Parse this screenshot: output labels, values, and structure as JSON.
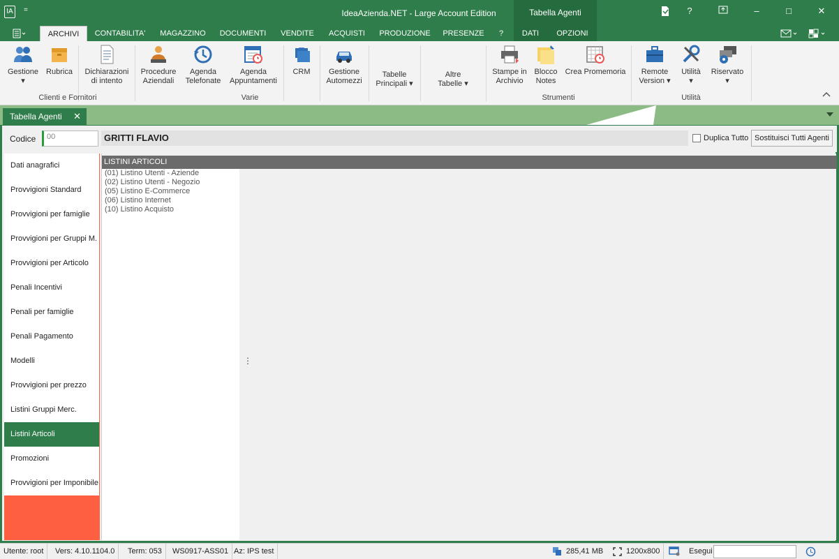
{
  "window": {
    "title": "IdeaAzienda.NET - Large Account Edition",
    "context_tab_title": "Tabella Agenti",
    "help_label": "?",
    "app_icon": "IA",
    "quick_access": "=",
    "controls": {
      "minimize": "–",
      "restore": "□",
      "close": "✕"
    }
  },
  "ribbon_tabs": [
    {
      "label": "ARCHIVI",
      "active": true
    },
    {
      "label": "CONTABILITA'"
    },
    {
      "label": "MAGAZZINO"
    },
    {
      "label": "DOCUMENTI"
    },
    {
      "label": "VENDITE"
    },
    {
      "label": "ACQUISTI"
    },
    {
      "label": "PRODUZIONE"
    },
    {
      "label": "PRESENZE"
    },
    {
      "label": "?"
    },
    {
      "label": "DATI"
    },
    {
      "label": "OPZIONI"
    }
  ],
  "ribbon": {
    "buttons": [
      {
        "label1": "Gestione",
        "label2": "▾",
        "icon": "users-icon"
      },
      {
        "label1": "Rubrica",
        "label2": "",
        "icon": "box-icon"
      },
      {
        "label1": "Dichiarazioni",
        "label2": "di intento",
        "icon": "document-icon"
      },
      {
        "label1": "Procedure",
        "label2": "Aziendali",
        "icon": "worker-icon"
      },
      {
        "label1": "Agenda",
        "label2": "Telefonate",
        "icon": "history-icon"
      },
      {
        "label1": "Agenda",
        "label2": "Appuntamenti",
        "icon": "calendar-clock-icon"
      },
      {
        "label1": "CRM",
        "label2": "",
        "icon": "briefcase-stack-icon"
      },
      {
        "label1": "Gestione",
        "label2": "Automezzi",
        "icon": "car-icon"
      },
      {
        "label1": "Tabelle",
        "label2": "Principali ▾",
        "icon": ""
      },
      {
        "label1": "Altre",
        "label2": "Tabelle ▾",
        "icon": ""
      },
      {
        "label1": "Stampe in",
        "label2": "Archivio",
        "icon": "printer-icon"
      },
      {
        "label1": "Blocco",
        "label2": "Notes",
        "icon": "sticky-note-icon"
      },
      {
        "label1": "Crea Promemoria",
        "label2": "",
        "icon": "calendar-clock-icon"
      },
      {
        "label1": "Remote",
        "label2": "Version ▾",
        "icon": "toolbox-icon"
      },
      {
        "label1": "Utilità",
        "label2": "▾",
        "icon": "tools-icon"
      },
      {
        "label1": "Riservato",
        "label2": "▾",
        "icon": "gear-window-icon"
      }
    ],
    "groups": [
      "Clienti e Fornitori",
      "Varie",
      "Strumenti",
      "Utilità"
    ]
  },
  "doc_tab": {
    "label": "Tabella Agenti",
    "close": "✕"
  },
  "header": {
    "codice_label": "Codice",
    "codice_value": "00",
    "agent_name": "GRITTI FLAVIO",
    "duplica_label": "Duplica Tutto",
    "sostituisci_label": "Sostituisci Tutti Agenti"
  },
  "sidebar": [
    "Dati anagrafici",
    "Provvigioni Standard",
    "Provvigioni per famiglie",
    "Provvigioni per Gruppi M.",
    "Provvigioni per Articolo",
    "Penali Incentivi",
    "Penali per famiglie",
    "Penali Pagamento",
    "Modelli",
    "Provvigioni per prezzo",
    "Listini Gruppi Merc.",
    "Listini Articoli",
    "Promozioni",
    "Provvigioni per Imponibile"
  ],
  "sidebar_active": "Listini Articoli",
  "list": {
    "header": "LISTINI ARTICOLI",
    "items": [
      "(01) Listino Utenti - Aziende",
      "(02) Listino Utenti - Negozio",
      "(05) Listino E-Commerce",
      "(06) Listino Internet",
      "(10) Listino Acquisto"
    ]
  },
  "status": {
    "user": "Utente: root",
    "version": "Vers: 4.10.1104.0",
    "term": "Term: 053",
    "ws": "WS0917-ASS01",
    "az": "Az: IPS test",
    "memory": "285,41 MB",
    "resolution": "1200x800",
    "esegui_label": "Esegui"
  },
  "colors": {
    "accent": "#2e7d4a",
    "sidebar_bg": "#ff5f41",
    "tabbar": "#8cbb86"
  }
}
